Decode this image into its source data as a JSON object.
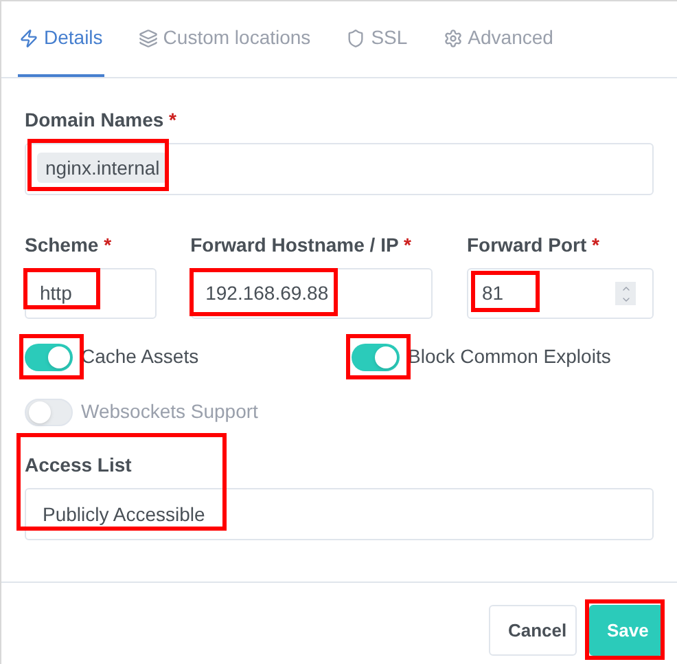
{
  "tabs": [
    {
      "label": "Details",
      "selected": true
    },
    {
      "label": "Custom locations",
      "selected": false
    },
    {
      "label": "SSL",
      "selected": false
    },
    {
      "label": "Advanced",
      "selected": false
    }
  ],
  "domain_names": {
    "label": "Domain Names",
    "required_mark": "*",
    "chip": "nginx.internal",
    "highlighted": true
  },
  "scheme": {
    "label": "Scheme",
    "required_mark": "*",
    "value": "http",
    "highlighted": true
  },
  "forward_host": {
    "label": "Forward Hostname / IP",
    "required_mark": "*",
    "value": "192.168.69.88",
    "highlighted": true
  },
  "forward_port": {
    "label": "Forward Port",
    "required_mark": "*",
    "value": "81",
    "highlighted": true
  },
  "toggles": [
    {
      "label": "Cache Assets",
      "on": true,
      "highlighted": true
    },
    {
      "label": "Block Common Exploits",
      "on": true,
      "highlighted": true
    },
    {
      "label": "Websockets Support",
      "on": false,
      "highlighted": false
    }
  ],
  "access_list": {
    "label": "Access List",
    "value": "Publicly Accessible",
    "highlighted": true
  },
  "buttons": [
    {
      "label": "Cancel",
      "kind": "secondary",
      "highlighted": false
    },
    {
      "label": "Save",
      "kind": "primary",
      "highlighted": true
    }
  ]
}
